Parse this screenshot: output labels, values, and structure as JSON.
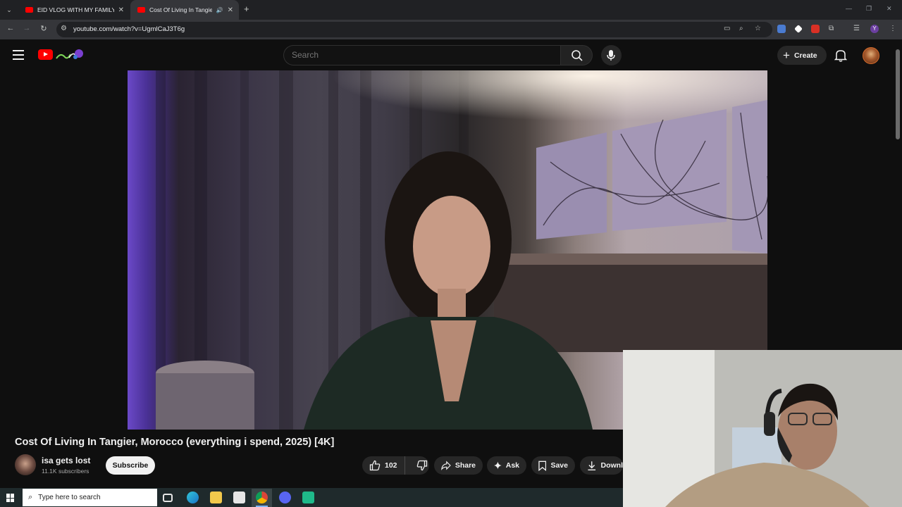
{
  "browser": {
    "tabs": [
      {
        "title": "EID VLOG WITH MY FAMILY I 😆",
        "active": false
      },
      {
        "title": "Cost Of Living In Tangier, M",
        "active": true
      }
    ],
    "url": "youtube.com/watch?v=UgmlCaJ3T6g",
    "profile_initial": "Y"
  },
  "youtube": {
    "search": {
      "placeholder": "Search"
    },
    "create_label": "Create",
    "video": {
      "title": "Cost Of Living In Tangier, Morocco (everything i spend, 2025) [4K]",
      "channel_name": "isa gets lost",
      "subscribers": "11.1K subscribers",
      "subscribe_label": "Subscribe",
      "likes": "102",
      "actions": {
        "share": "Share",
        "ask": "Ask",
        "save": "Save",
        "download": "Downl"
      }
    }
  },
  "taskbar": {
    "search_placeholder": "Type here to search"
  },
  "colors": {
    "yt_red": "#ff0000",
    "background": "#0f0f0f",
    "chip": "#272727"
  }
}
